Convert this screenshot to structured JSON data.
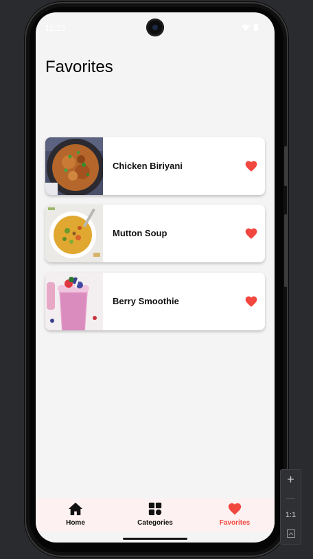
{
  "status_bar": {
    "time": "11:23"
  },
  "page": {
    "title": "Favorites"
  },
  "favorites": [
    {
      "name": "Chicken Biriyani",
      "image_icon": "biriyani-image",
      "favorited": true
    },
    {
      "name": "Mutton Soup",
      "image_icon": "soup-image",
      "favorited": true
    },
    {
      "name": "Berry Smoothie",
      "image_icon": "smoothie-image",
      "favorited": true
    }
  ],
  "bottom_nav": {
    "items": [
      {
        "label": "Home",
        "icon": "home-icon"
      },
      {
        "label": "Categories",
        "icon": "grid-icon"
      },
      {
        "label": "Favorites",
        "icon": "heart-icon"
      }
    ],
    "active_index": 2
  },
  "emulator_controls": {
    "zoom_ratio": "1:1"
  },
  "colors": {
    "accent": "#f2473f",
    "background": "#f4f4f4",
    "nav_background": "#fdf2f1",
    "card": "#ffffff"
  }
}
